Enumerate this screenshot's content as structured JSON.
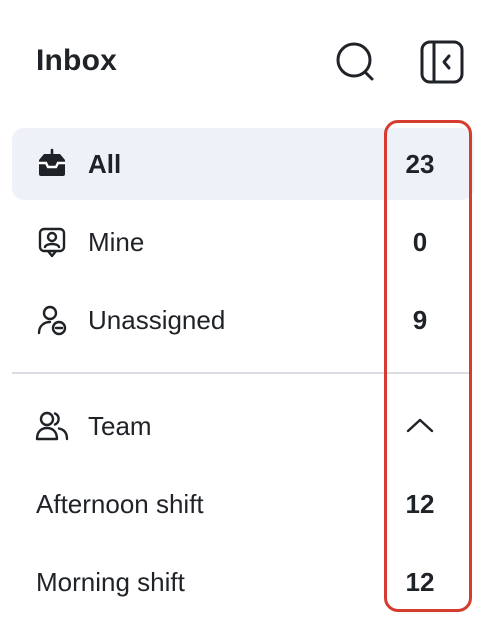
{
  "header": {
    "title": "Inbox",
    "search_icon": "search-icon",
    "collapse_icon": "sidebar-collapse-icon"
  },
  "nav": {
    "items": [
      {
        "label": "All",
        "count": "23",
        "icon": "inbox-icon",
        "active": true
      },
      {
        "label": "Mine",
        "count": "0",
        "icon": "user-badge-icon",
        "active": false
      },
      {
        "label": "Unassigned",
        "count": "9",
        "icon": "user-minus-icon",
        "active": false
      }
    ]
  },
  "team": {
    "label": "Team",
    "icon": "users-icon",
    "toggle_icon": "chevron-up-icon",
    "items": [
      {
        "label": "Afternoon shift",
        "count": "12"
      },
      {
        "label": "Morning shift",
        "count": "12"
      }
    ]
  },
  "colors": {
    "active_bg": "#eef2f8",
    "highlight_border": "#d63b2f",
    "text": "#1f2328",
    "divider": "#dadde3"
  }
}
